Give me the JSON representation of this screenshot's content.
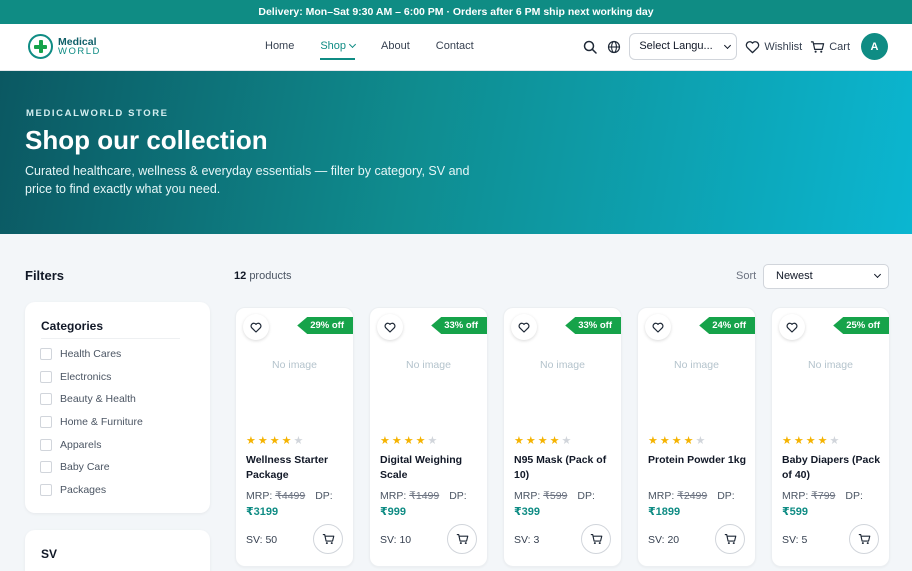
{
  "topbar": {
    "text": "Delivery: Mon–Sat 9:30 AM – 6:00 PM · Orders after 6 PM ship next working day"
  },
  "brand": {
    "line1": "Medical",
    "line2": "WORLD",
    "primary": "#0f8c84",
    "accent": "#16a34a"
  },
  "nav": {
    "links": [
      {
        "label": "Home"
      },
      {
        "label": "Shop",
        "active": true
      },
      {
        "label": "About"
      },
      {
        "label": "Contact"
      }
    ],
    "language": "Select Langu...",
    "wishlist": "Wishlist",
    "cart": "Cart",
    "avatar": "A",
    "icons": [
      "search-icon",
      "globe-icon",
      "heart-icon",
      "cart-icon"
    ]
  },
  "hero": {
    "eyebrow": "MEDICALWORLD STORE",
    "title": "Shop our collection",
    "subtitle": "Curated healthcare, wellness & everyday essentials — filter by category, SV and price to find exactly what you need."
  },
  "filters": {
    "title": "Filters",
    "categories_title": "Categories",
    "categories": [
      "Health Cares",
      "Electronics",
      "Beauty & Health",
      "Home & Furniture",
      "Apparels",
      "Baby Care",
      "Packages"
    ],
    "sv_title": "SV"
  },
  "results": {
    "count": "12",
    "count_label": "products",
    "sort_label": "Sort",
    "sort_value": "Newest"
  },
  "products": [
    {
      "badge": "29% off",
      "image_text": "No image",
      "rating": 4,
      "name": "Wellness Starter Package",
      "mrp_label": "MRP:",
      "mrp": "₹4499",
      "dp_label": "DP:",
      "price": "₹3199",
      "sv": "SV: 50"
    },
    {
      "badge": "33% off",
      "image_text": "No image",
      "rating": 4,
      "name": "Digital Weighing Scale",
      "mrp_label": "MRP:",
      "mrp": "₹1499",
      "dp_label": "DP:",
      "price": "₹999",
      "sv": "SV: 10"
    },
    {
      "badge": "33% off",
      "image_text": "No image",
      "rating": 4,
      "name": "N95 Mask (Pack of 10)",
      "mrp_label": "MRP:",
      "mrp": "₹599",
      "dp_label": "DP:",
      "price": "₹399",
      "sv": "SV: 3"
    },
    {
      "badge": "24% off",
      "image_text": "No image",
      "rating": 4,
      "name": "Protein Powder 1kg",
      "mrp_label": "MRP:",
      "mrp": "₹2499",
      "dp_label": "DP:",
      "price": "₹1899",
      "sv": "SV: 20"
    },
    {
      "badge": "25% off",
      "image_text": "No image",
      "rating": 4,
      "name": "Baby Diapers (Pack of 40)",
      "mrp_label": "MRP:",
      "mrp": "₹799",
      "dp_label": "DP:",
      "price": "₹599",
      "sv": "SV: 5"
    }
  ]
}
